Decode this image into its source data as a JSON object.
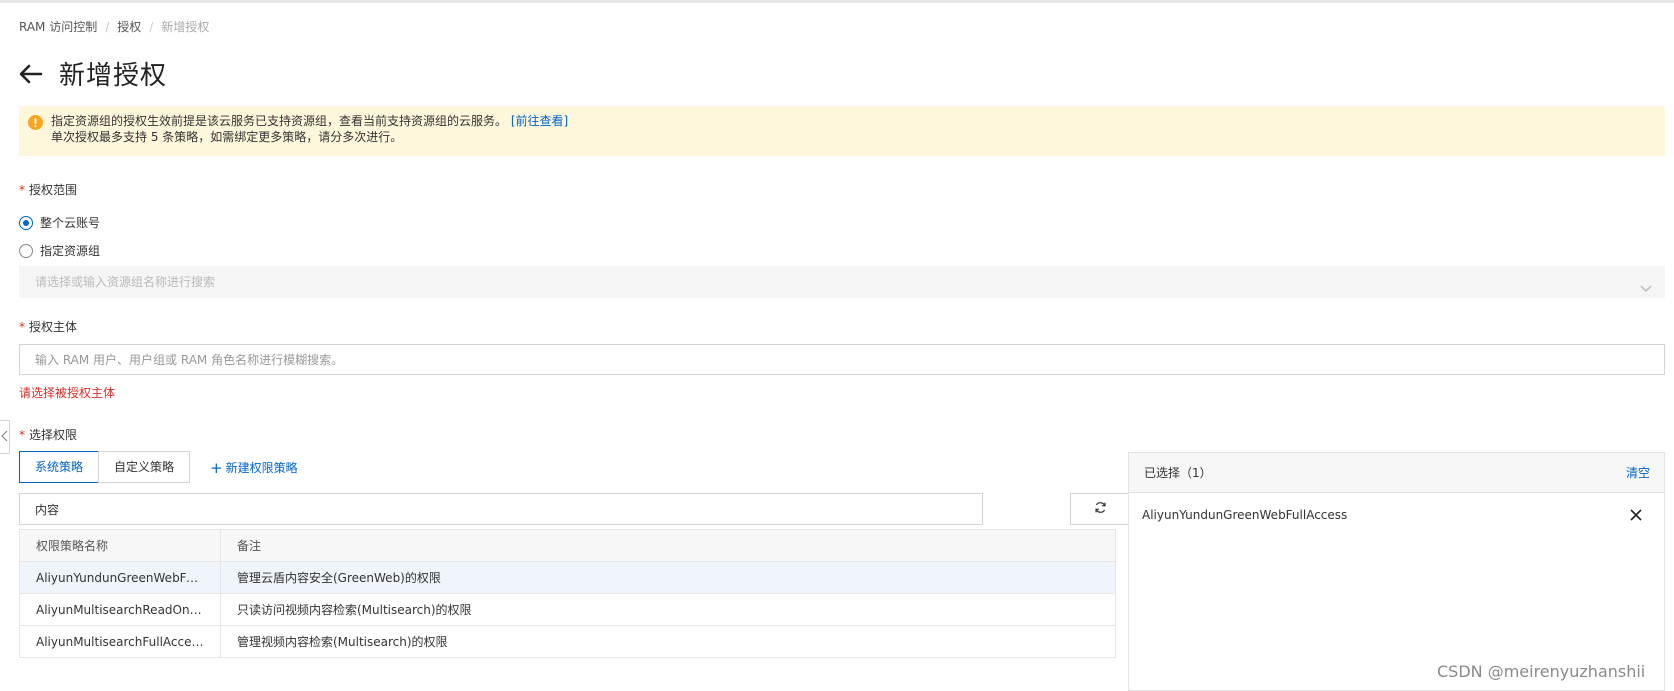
{
  "breadcrumb": {
    "item1": "RAM 访问控制",
    "item2": "授权",
    "current": "新增授权",
    "separator": "/"
  },
  "page": {
    "title": "新增授权"
  },
  "alert": {
    "line1": "指定资源组的授权生效前提是该云服务已支持资源组，查看当前支持资源组的云服务。",
    "link": "[前往查看]",
    "line2": "单次授权最多支持 5 条策略，如需绑定更多策略，请分多次进行。"
  },
  "scope": {
    "label": "授权范围",
    "required_mark": "*",
    "option_account": "整个云账号",
    "option_group": "指定资源组",
    "selected": "整个云账号",
    "group_select_placeholder": "请选择或输入资源组名称进行搜索"
  },
  "principal": {
    "label": "授权主体",
    "required_mark": "*",
    "placeholder": "输入 RAM 用户、用户组或 RAM 角色名称进行模糊搜索。",
    "value": "",
    "error": "请选择被授权主体"
  },
  "permissions": {
    "label": "选择权限",
    "required_mark": "*",
    "tabs": [
      {
        "label": "系统策略",
        "active": true
      },
      {
        "label": "自定义策略",
        "active": false
      }
    ],
    "new_policy_label": "新建权限策略",
    "search_value": "内容",
    "table": {
      "headers": [
        "权限策略名称",
        "备注"
      ],
      "rows": [
        {
          "name": "AliyunYundunGreenWebFullA...",
          "note": "管理云盾内容安全(GreenWeb)的权限"
        },
        {
          "name": "AliyunMultisearchReadOnlyA...",
          "note": "只读访问视频内容检索(Multisearch)的权限"
        },
        {
          "name": "AliyunMultisearchFullAcces...",
          "note": "管理视频内容检索(Multisearch)的权限"
        }
      ]
    }
  },
  "selected_panel": {
    "title": "已选择（1）",
    "clear_label": "清空",
    "items": [
      "AliyunYundunGreenWebFullAccess"
    ]
  },
  "watermark": "CSDN @meirenyuzhanshii",
  "colors": {
    "accent": "#0064c8",
    "error": "#d93026",
    "warning_bg": "#fff7db",
    "warning_icon": "#f5a623"
  }
}
